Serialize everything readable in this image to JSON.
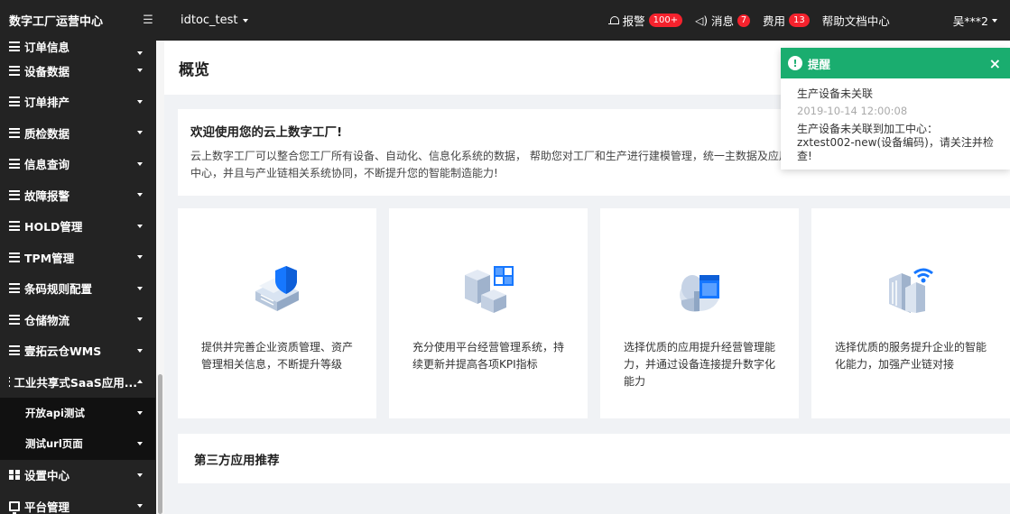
{
  "sidebar": {
    "title": "数字工厂运营中心",
    "toggle_icon": "menu-fold-icon",
    "partial_item": "订单信息",
    "items": [
      {
        "label": "设备数据",
        "icon": "list-icon"
      },
      {
        "label": "订单排产",
        "icon": "list-icon"
      },
      {
        "label": "质检数据",
        "icon": "list-icon"
      },
      {
        "label": "信息查询",
        "icon": "list-icon"
      },
      {
        "label": "故障报警",
        "icon": "list-icon"
      },
      {
        "label": "HOLD管理",
        "icon": "list-icon"
      },
      {
        "label": "TPM管理",
        "icon": "list-icon"
      },
      {
        "label": "条码规则配置",
        "icon": "list-icon"
      },
      {
        "label": "仓储物流",
        "icon": "list-icon"
      },
      {
        "label": "壹拓云仓WMS",
        "icon": "list-icon"
      },
      {
        "label": "工业共享式SaaS应用...",
        "icon": "list-icon",
        "expanded": true
      }
    ],
    "subitems": [
      {
        "label": "开放api测试"
      },
      {
        "label": "测试url页面"
      }
    ],
    "bottom_items": [
      {
        "label": "设置中心",
        "icon": "grid-icon"
      },
      {
        "label": "平台管理",
        "icon": "monitor-icon"
      }
    ]
  },
  "topbar": {
    "env": "idtoc_test",
    "alarm_label": "报警",
    "alarm_badge": "100+",
    "message_label": "消息",
    "message_badge": "7",
    "fee_label": "费用",
    "fee_badge": "13",
    "help_label": "帮助文档中心",
    "user": "吴***2"
  },
  "page": {
    "title": "概览",
    "welcome_title": "欢迎使用您的云上数字工厂!",
    "welcome_text": "云上数字工厂可以整合您工厂所有设备、自动化、信息化系统的数据， 帮助您对工厂和生产进行建模管理，统一主数据及应用中心，并且与产业链相关系统协同，不断提升您的智能制造能力!",
    "cards": [
      {
        "icon": "shield-server-icon",
        "text": "提供并完善企业资质管理、资产管理相关信息，不断提升等级"
      },
      {
        "icon": "cube-grid-icon",
        "text": "充分使用平台经营管理系统，持续更新并提高各项KPI指标"
      },
      {
        "icon": "cloud-app-icon",
        "text": "选择优质的应用提升经营管理能力，并通过设备连接提升数字化能力"
      },
      {
        "icon": "wifi-building-icon",
        "text": "选择优质的服务提升企业的智能化能力，加强产业链对接"
      }
    ],
    "third_party_title": "第三方应用推荐"
  },
  "notification": {
    "title": "提醒",
    "subject": "生产设备未关联",
    "time": "2019-10-14 12:00:08",
    "message": "生产设备未关联到加工中心：zxtest002-new(设备编码)，请关注并检查!",
    "accent": "#1aad6f"
  }
}
